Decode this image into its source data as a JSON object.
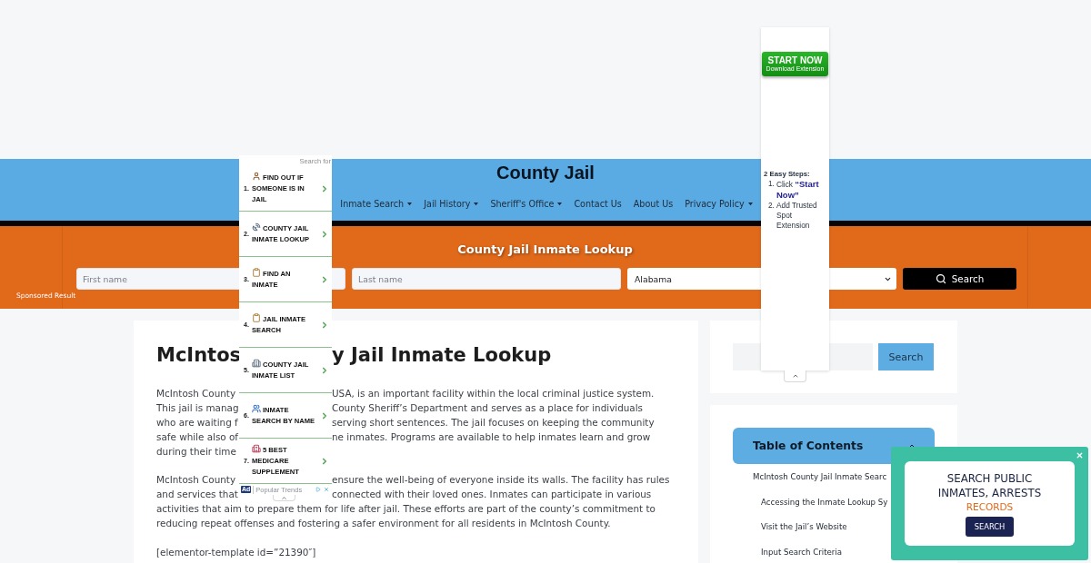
{
  "site": {
    "title": "County Jail"
  },
  "nav": {
    "items": [
      {
        "label": "Inmate Search",
        "has_submenu": true
      },
      {
        "label": "Jail History",
        "has_submenu": true
      },
      {
        "label": "Sheriff's Office",
        "has_submenu": true
      },
      {
        "label": "Contact Us",
        "has_submenu": false
      },
      {
        "label": "About Us",
        "has_submenu": false
      },
      {
        "label": "Privacy Policy",
        "has_submenu": true
      }
    ]
  },
  "lookup_banner": {
    "sponsored_label": "Sponsored Result",
    "title": "County Jail Inmate Lookup",
    "first_name": {
      "placeholder": "First name"
    },
    "last_name": {
      "placeholder": "Last name"
    },
    "state_select": {
      "value": "Alabama"
    },
    "search_button": "Search"
  },
  "article": {
    "title_left": "McIntos",
    "title_right": "y Jail Inmate Lookup",
    "paragraphs": [
      {
        "lines": [
          {
            "left": "McIntosh County",
            "right": "USA, is an important facility within the local criminal justice system."
          },
          {
            "left": "This jail is manag",
            "right": "County Sheriff’s Department and serves as a place for individuals"
          },
          {
            "left": "who are waiting f",
            "right": "serving short sentences. The jail focuses on keeping the community"
          },
          {
            "left": "safe while also of",
            "right": "ne inmates. Programs are available to help inmates learn and grow"
          },
          {
            "left": "during their time"
          }
        ]
      },
      {
        "lines": [
          {
            "left": "McIntosh County",
            "right": "ensure the well-being of everyone inside its walls. The facility has rules"
          },
          {
            "left": "and services that",
            "right": "connected with their loved ones. Inmates can participate in various"
          },
          {
            "text": "activities that aim to prepare them for life after jail. These efforts are part of the county’s commitment to"
          },
          {
            "text": "reducing repeat offenses and fostering a safer environment for all residents in McIntosh County."
          }
        ]
      }
    ],
    "shortcode": "[elementor-template id=”21390″]"
  },
  "sidebar": {
    "search": {
      "button": "Search"
    },
    "toc": {
      "title": "Table of Contents",
      "expanded": true,
      "items": [
        {
          "label": "McIntosh County Jail Inmate Searc",
          "children": [
            {
              "label": "Accessing the Inmate Lookup Sy"
            },
            {
              "label": "Visit the Jail’s Website"
            },
            {
              "label": "Input Search Criteria"
            }
          ]
        }
      ]
    }
  },
  "left_ad": {
    "header": "Search for",
    "items": [
      {
        "number": "1.",
        "label": "FIND OUT IF SOMEONE IS IN JAIL"
      },
      {
        "number": "2.",
        "label": "COUNTY JAIL INMATE LOOKUP"
      },
      {
        "number": "3.",
        "label": "FIND AN INMATE"
      },
      {
        "number": "4.",
        "label": "JAIL INMATE SEARCH"
      },
      {
        "number": "5.",
        "label": "COUNTY JAIL INMATE LIST"
      },
      {
        "number": "6.",
        "label": "INMATE SEARCH BY NAME"
      },
      {
        "number": "7.",
        "label": "5 BEST MEDICARE SUPPLEMENT"
      }
    ],
    "footer": {
      "badge": "Ad",
      "label": "Popular Trends"
    }
  },
  "right_ad": {
    "button": {
      "label": "START NOW",
      "sublabel": "Download Extension"
    },
    "steps_title": "2 Easy Steps:",
    "steps": [
      {
        "number": "1.",
        "text": "Click **“Start Now”**"
      },
      {
        "number": "2.",
        "text": "Add Trusted Spot Extension"
      }
    ]
  },
  "popup": {
    "headline": "SEARCH PUBLIC INMATES, ARRESTS",
    "highlight": "RECORDS",
    "button": "SEARCH"
  }
}
